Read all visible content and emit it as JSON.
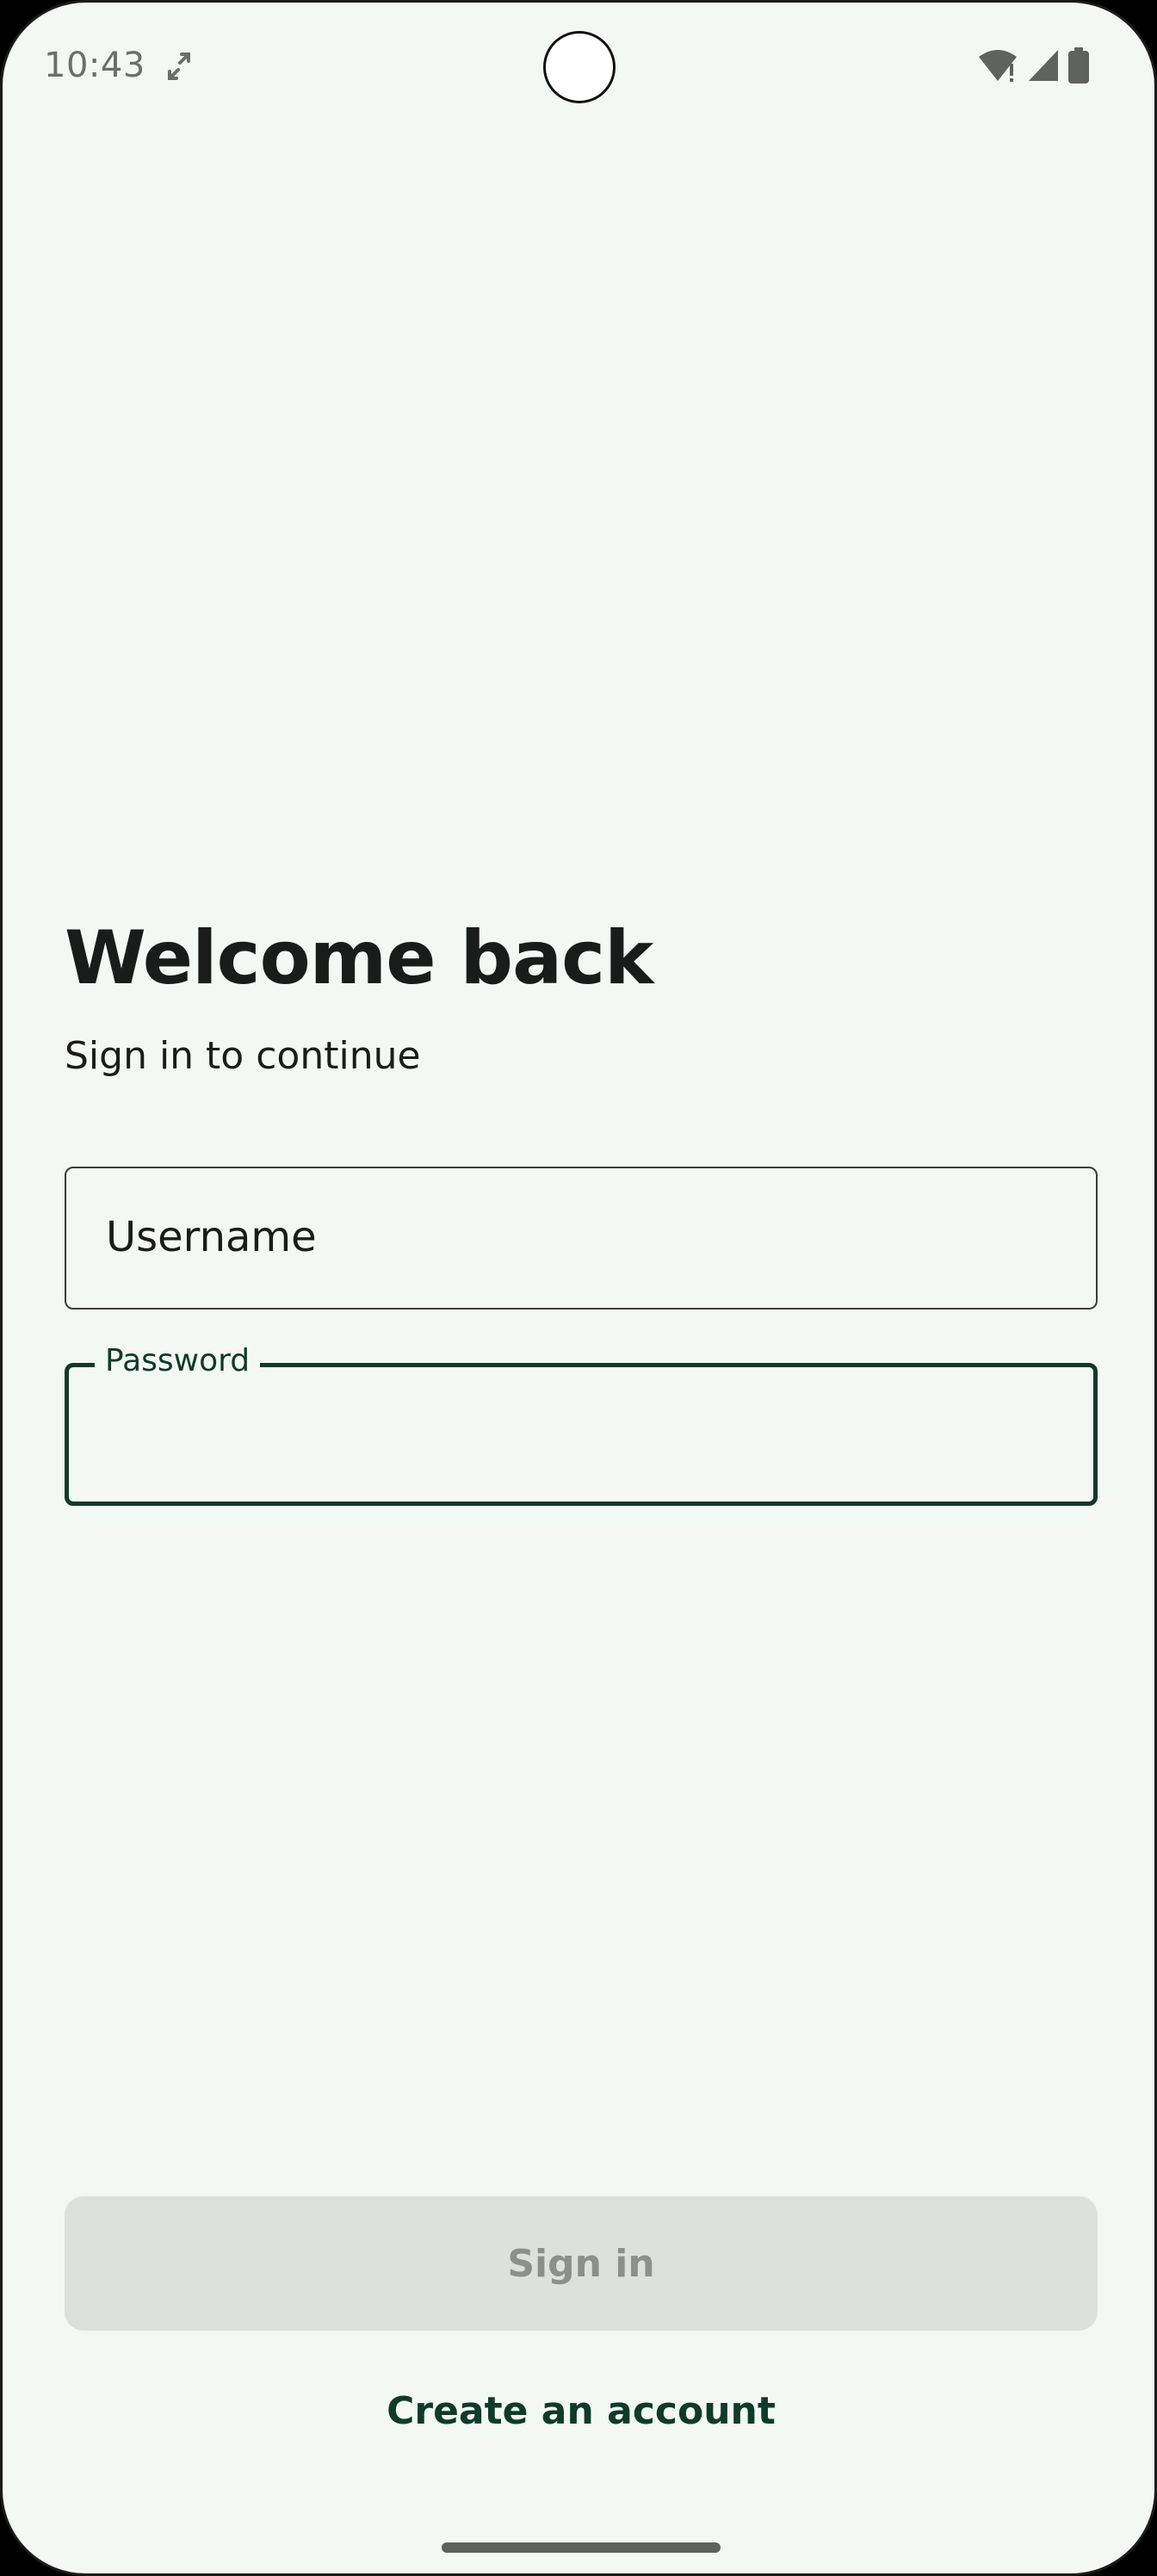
{
  "status_bar": {
    "time": "10:43",
    "icons": [
      "screen-rotate-icon",
      "wifi-icon",
      "cellular-signal-icon",
      "battery-icon"
    ]
  },
  "login": {
    "title": "Welcome back",
    "subtitle": "Sign in to continue",
    "username_placeholder": "Username",
    "username_value": "",
    "password_label": "Password",
    "password_value": "",
    "signin_label": "Sign in",
    "create_account_label": "Create an account"
  },
  "colors": {
    "background": "#f3f8f4",
    "accent": "#0f3a2c",
    "button_disabled_bg": "#dde0dd",
    "button_disabled_text": "#8c8f8d"
  }
}
